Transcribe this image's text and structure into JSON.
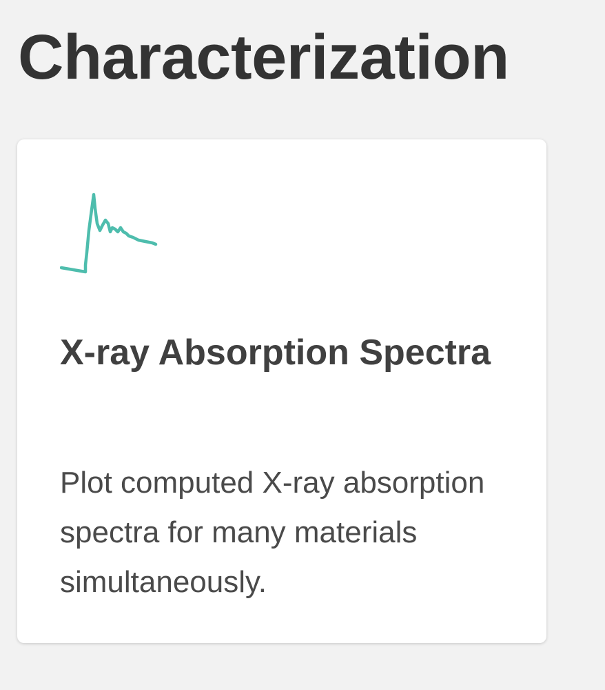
{
  "section": {
    "title": "Characterization"
  },
  "card": {
    "icon": "xray-spectrum-icon",
    "icon_color": "#4ebdad",
    "title": "X-ray Absorption Spectra",
    "description": "Plot computed X-ray absorption spectra for many materials simultaneously."
  }
}
